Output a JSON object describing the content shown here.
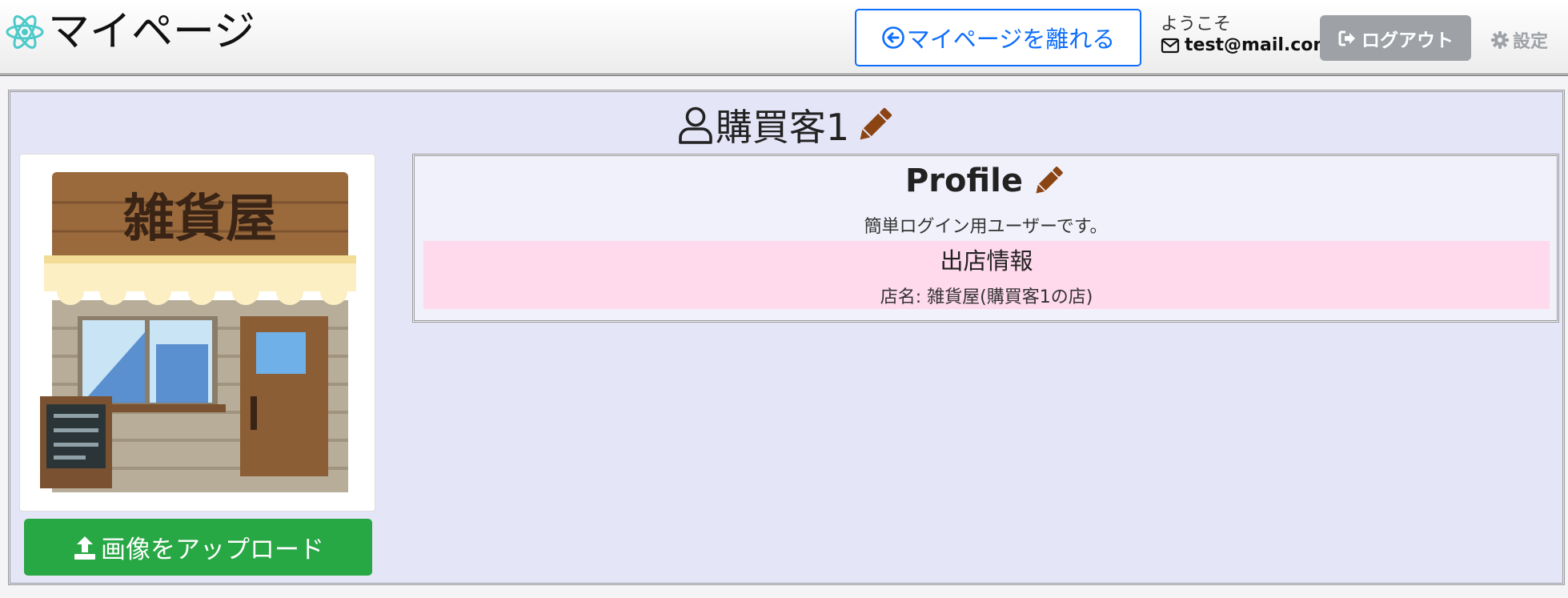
{
  "header": {
    "title": "マイページ",
    "leave_label": "マイページを離れる",
    "welcome": "ようこそ",
    "email": "test@mail.com",
    "logout_label": "ログアウト",
    "settings_label": "設定"
  },
  "main": {
    "user_name": "購買客1",
    "upload_label": "画像をアップロード",
    "shop_sign_text": "雑貨屋",
    "profile": {
      "title": "Profile",
      "description": "簡単ログイン用ユーザーです。",
      "shop_section_title": "出店情報",
      "shop_name": "店名: 雑貨屋(購買客1の店)"
    }
  },
  "colors": {
    "primary": "#0d6efd",
    "success": "#28a745",
    "secondary": "#9ea2a7",
    "edit_icon": "#8b4513",
    "page_bg": "#e5e5f8",
    "shop_bg": "#ffd9ec"
  },
  "icons": {
    "brand": "atom-icon",
    "leave": "arrow-left-circle-icon",
    "email": "envelope-icon",
    "logout": "sign-out-icon",
    "settings": "gear-icon",
    "user": "user-icon",
    "edit": "pencil-icon",
    "upload": "upload-icon"
  }
}
